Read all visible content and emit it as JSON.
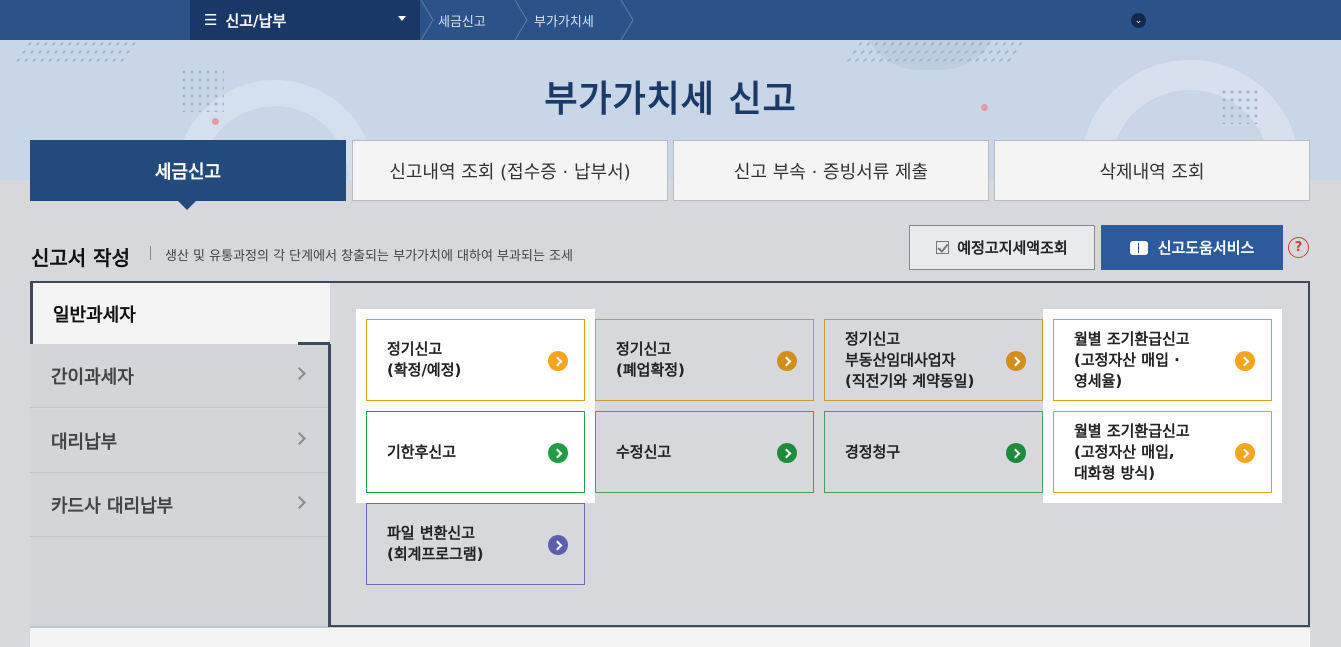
{
  "nav": {
    "current": "신고/납부",
    "crumbs": [
      "세금신고",
      "부가가치세"
    ]
  },
  "hero": {
    "title": "부가가치세 신고"
  },
  "tabs": [
    {
      "label": "세금신고",
      "active": true
    },
    {
      "label": "신고내역 조회 (접수증 · 납부서)",
      "active": false
    },
    {
      "label": "신고 부속 · 증빙서류 제출",
      "active": false
    },
    {
      "label": "삭제내역 조회",
      "active": false
    }
  ],
  "section": {
    "title": "신고서 작성",
    "description": "생산 및 유통과정의 각 단계에서 창출되는 부가가치에 대하여 부과되는 조세",
    "preview_button": "예정고지세액조회",
    "help_button": "신고도움서비스",
    "help_icon": "?"
  },
  "sidebar": {
    "items": [
      {
        "label": "일반과세자",
        "active": true
      },
      {
        "label": "간이과세자",
        "active": false
      },
      {
        "label": "대리납부",
        "active": false
      },
      {
        "label": "카드사 대리납부",
        "active": false
      }
    ]
  },
  "cards": [
    {
      "label": "정기신고\n(확정/예정)",
      "color": "yellow",
      "highlight": true
    },
    {
      "label": "정기신고\n(폐업확정)",
      "color": "yellow",
      "highlight": false
    },
    {
      "label": "정기신고\n부동산임대사업자\n(직전기와 계약동일)",
      "color": "yellow",
      "highlight": false
    },
    {
      "label": "월별 조기환급신고\n(고정자산 매입 ·\n영세율)",
      "color": "yellow",
      "highlight": true
    },
    {
      "label": "기한후신고",
      "color": "green",
      "highlight": true
    },
    {
      "label": "수정신고",
      "color": "green",
      "highlight": false
    },
    {
      "label": "경정청구",
      "color": "green",
      "highlight": false
    },
    {
      "label": "월별 조기환급신고\n(고정자산 매입,\n대화형 방식)",
      "color": "yellow",
      "highlight": true
    },
    {
      "label": "파일 변환신고\n(회계프로그램)",
      "color": "purple",
      "highlight": false
    }
  ],
  "colors": {
    "nav_bg": "#2c5389",
    "tab_active": "#234a7c",
    "help_button": "#2c5a9b",
    "card_yellow": "#f5a51f",
    "card_green": "#1f9e43",
    "card_purple": "#5c5fae"
  }
}
